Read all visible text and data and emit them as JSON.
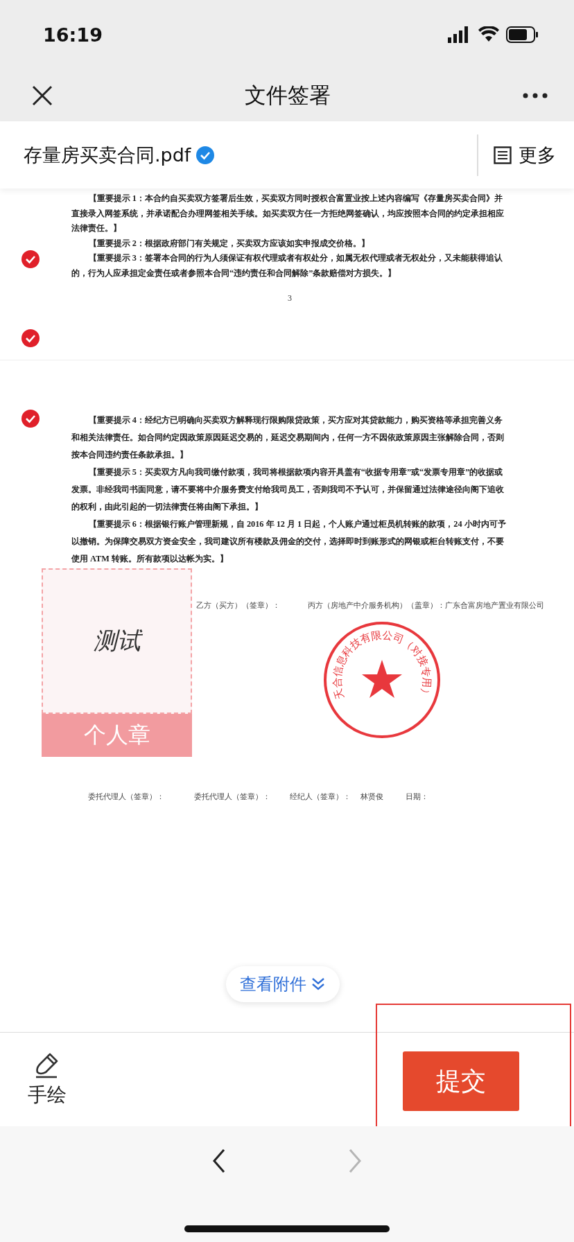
{
  "status_bar": {
    "time": "16:19"
  },
  "nav": {
    "title": "文件签署"
  },
  "file": {
    "name": "存量房买卖合同.pdf",
    "verified": true,
    "more_label": "更多"
  },
  "sign_markers": [
    {
      "done": true
    },
    {
      "done": true
    },
    {
      "done": true
    }
  ],
  "pages": [
    {
      "paragraphs": [
        "【重要提示 1：本合约自买卖双方签署后生效，买卖双方同时授权合富置业按上述内容编写《存量房买卖合同》并直接录入网签系统，并承诺配合办理网签相关手续。如买卖双方任一方拒绝网签确认，均应按照本合同的约定承担相应法律责任。】",
        "【重要提示 2：根据政府部门有关规定，买卖双方应该如实申报成交价格。】",
        "【重要提示 3：签署本合同的行为人须保证有权代理或者有权处分，如属无权代理或者无权处分，又未能获得追认的，行为人应承担定金责任或者参照本合同“违约责任和合同解除”条款赔偿对方损失。】"
      ],
      "page_number": "3"
    },
    {
      "paragraphs": [
        "【重要提示 4：经纪方已明确向买卖双方解释现行限购限贷政策，买方应对其贷款能力，购买资格等承担完善义务和相关法律责任。如合同约定因政策原因延迟交易的，延迟交易期间内，任何一方不因依政策原因主张解除合同，否则按本合同违约责任条款承担。】",
        "【重要提示 5：买卖双方凡向我司缴付款项，我司将根据款项内容开具盖有“收据专用章”或“发票专用章”的收据或发票。非经我司书面同意，请不要将中介服务费支付给我司员工，否则我司不予认可，并保留通过法律途径向阁下追收的权利，由此引起的一切法律责任将由阁下承担。】",
        "【重要提示 6：根据银行账户管理新规，自 2016 年 12 月 1 日起，个人账户通过柜员机转账的款项，24 小时内可予以撤销。为保障交易双方资金安全，我司建议所有楼款及佣金的交付，选择即时到账形式的网银或柜台转账支付，不要使用 ATM 转账。所有款项以达帐为实。】"
      ]
    }
  ],
  "party_labels": [
    "乙方（买方）（签章）：",
    "丙方（房地产中介服务机构）（盖章）：广东合富房地产置业有限公司"
  ],
  "seal": {
    "text": "天合信息科技有限公司（对接专用）"
  },
  "stamp_box": {
    "signature": "测试",
    "label": "个人章"
  },
  "agent_row": [
    "委托代理人（签章）：",
    "委托代理人（签章）：",
    "经纪人（签章）：",
    "林贤俊",
    "日期："
  ],
  "attachments_button": "查看附件",
  "toolbar": {
    "draw_label": "手绘",
    "submit_label": "提交",
    "submit_highlighted": true
  },
  "pager": {
    "prev_disabled": false,
    "next_disabled": true
  }
}
